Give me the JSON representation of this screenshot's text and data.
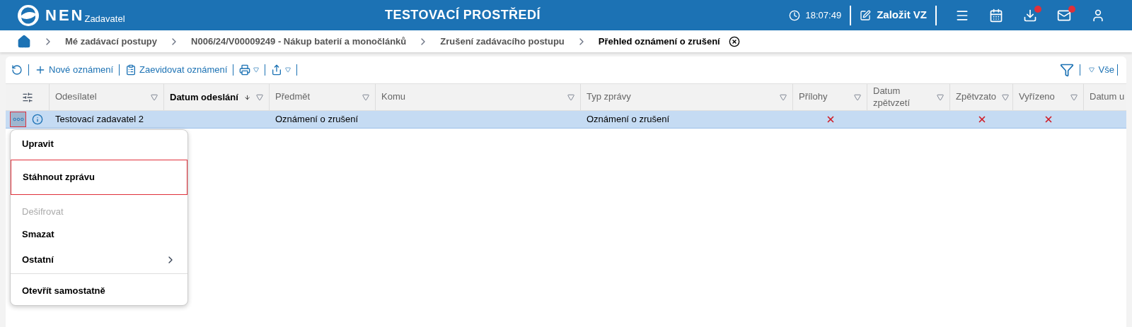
{
  "header": {
    "brand": "NEN",
    "subbrand": "Zadavatel",
    "title": "TESTOVACÍ PROSTŘEDÍ",
    "time": "18:07:49",
    "create_button": "Založit VZ",
    "icons": [
      {
        "kind": "menu",
        "badge": false
      },
      {
        "kind": "calendar",
        "badge": false
      },
      {
        "kind": "download",
        "badge": true
      },
      {
        "kind": "mail",
        "badge": true
      },
      {
        "kind": "user",
        "badge": false
      }
    ]
  },
  "breadcrumbs": [
    {
      "label": "Mé zadávací postupy",
      "current": false
    },
    {
      "label": "N006/24/V00009249 - Nákup baterií a monočlánků",
      "current": false
    },
    {
      "label": "Zrušení zadávacího postupu",
      "current": false
    },
    {
      "label": "Přehled oznámení o zrušení",
      "current": true
    }
  ],
  "toolbar": {
    "new_button": "Nové oznámení",
    "register_button": "Zaevidovat oznámení",
    "filter_label": "Vše"
  },
  "table": {
    "columns": [
      {
        "label": "Odesílatel",
        "sorted": false,
        "filter": true
      },
      {
        "label": "Datum odeslání",
        "sorted": true,
        "filter": true
      },
      {
        "label": "Předmět",
        "sorted": false,
        "filter": true
      },
      {
        "label": "Komu",
        "sorted": false,
        "filter": true
      },
      {
        "label": "Typ zprávy",
        "sorted": false,
        "filter": true
      },
      {
        "label": "Přílohy",
        "sorted": false,
        "filter": true
      },
      {
        "label": "Datum zpětvzetí",
        "sorted": false,
        "filter": true
      },
      {
        "label": "Zpětvzato",
        "sorted": false,
        "filter": true
      },
      {
        "label": "Vyřízeno",
        "sorted": false,
        "filter": true
      },
      {
        "label": "Datum u",
        "sorted": false,
        "filter": false
      }
    ],
    "rows": [
      {
        "selected": true,
        "menu_highlighted": true,
        "cells": [
          {
            "kind": "text",
            "text": "Testovací zadavatel 2"
          },
          {
            "kind": "empty"
          },
          {
            "kind": "text",
            "text": "Oznámení o zrušení"
          },
          {
            "kind": "empty"
          },
          {
            "kind": "text",
            "text": "Oznámení o zrušení"
          },
          {
            "kind": "cross"
          },
          {
            "kind": "empty"
          },
          {
            "kind": "cross"
          },
          {
            "kind": "cross"
          },
          {
            "kind": "empty"
          }
        ]
      }
    ]
  },
  "context_menu": [
    {
      "label": "Upravit",
      "disabled": false,
      "highlighted": false,
      "submenu": false,
      "divider_after": false
    },
    {
      "label": "Stáhnout zprávu",
      "disabled": false,
      "highlighted": true,
      "submenu": false,
      "divider_after": false
    },
    {
      "label": "Dešifrovat",
      "disabled": true,
      "highlighted": false,
      "submenu": false,
      "divider_after": false
    },
    {
      "label": "Smazat",
      "disabled": false,
      "highlighted": false,
      "submenu": false,
      "divider_after": false
    },
    {
      "label": "Ostatní",
      "disabled": false,
      "highlighted": false,
      "submenu": true,
      "divider_after": true
    },
    {
      "label": "Otevřít samostatně",
      "disabled": false,
      "highlighted": false,
      "submenu": false,
      "divider_after": false
    }
  ]
}
